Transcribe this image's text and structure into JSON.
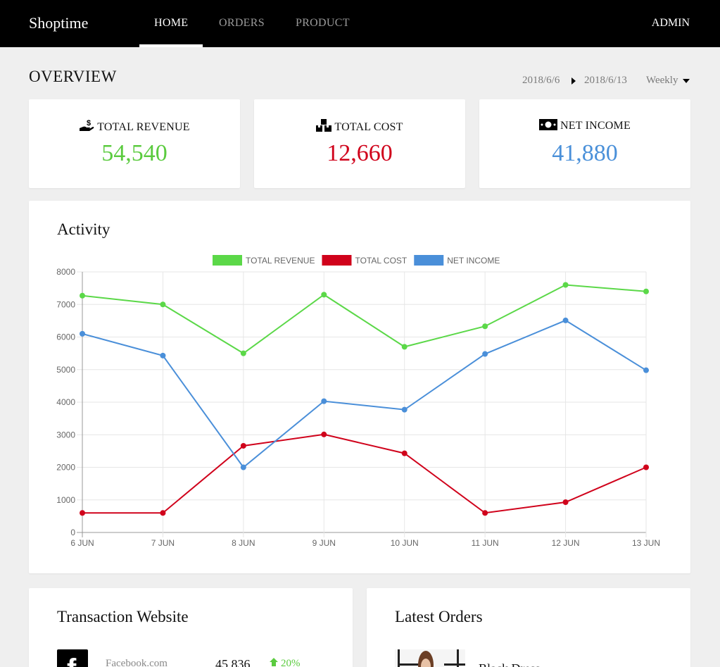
{
  "nav": {
    "brand": "Shoptime",
    "items": [
      {
        "label": "HOME",
        "active": true
      },
      {
        "label": "ORDERS",
        "active": false
      },
      {
        "label": "PRODUCT",
        "active": false
      }
    ],
    "user": "ADMIN"
  },
  "overview": {
    "title": "OVERVIEW",
    "date_from": "2018/6/6",
    "date_to": "2018/6/13",
    "period": "Weekly"
  },
  "stats": [
    {
      "label": "TOTAL REVENUE",
      "value": "54,540",
      "color": "#5bcb3f",
      "icon": "hand-money-icon"
    },
    {
      "label": "TOTAL COST",
      "value": "12,660",
      "color": "#d0021b",
      "icon": "boxes-icon"
    },
    {
      "label": "NET INCOME",
      "value": "41,880",
      "color": "#4a90d9",
      "icon": "banknote-icon"
    }
  ],
  "activity": {
    "title": "Activity"
  },
  "chart_data": {
    "type": "line",
    "x": [
      "6 JUN",
      "7 JUN",
      "8 JUN",
      "9 JUN",
      "10 JUN",
      "11 JUN",
      "12 JUN",
      "13 JUN"
    ],
    "ylim": [
      0,
      8000
    ],
    "yticks": [
      "0",
      "1000",
      "2000",
      "3000",
      "4000",
      "5000",
      "6000",
      "7000",
      "8000"
    ],
    "grid": true,
    "legend_position": "top",
    "series": [
      {
        "name": "TOTAL REVENUE",
        "color": "#5bd848",
        "values": [
          7270,
          7000,
          5500,
          7300,
          5700,
          6330,
          7600,
          7400
        ]
      },
      {
        "name": "TOTAL COST",
        "color": "#d0021b",
        "values": [
          600,
          600,
          2660,
          3010,
          2430,
          600,
          930,
          2000
        ]
      },
      {
        "name": "NET INCOME",
        "color": "#4a8fd9",
        "values": [
          6100,
          5430,
          2000,
          4030,
          3770,
          5480,
          6510,
          4980
        ]
      }
    ]
  },
  "transactions": {
    "title": "Transaction Website",
    "site": "Facebook.com",
    "value": "45,836",
    "change": "20%"
  },
  "orders": {
    "title": "Latest Orders",
    "first_name": "Black Dress"
  }
}
